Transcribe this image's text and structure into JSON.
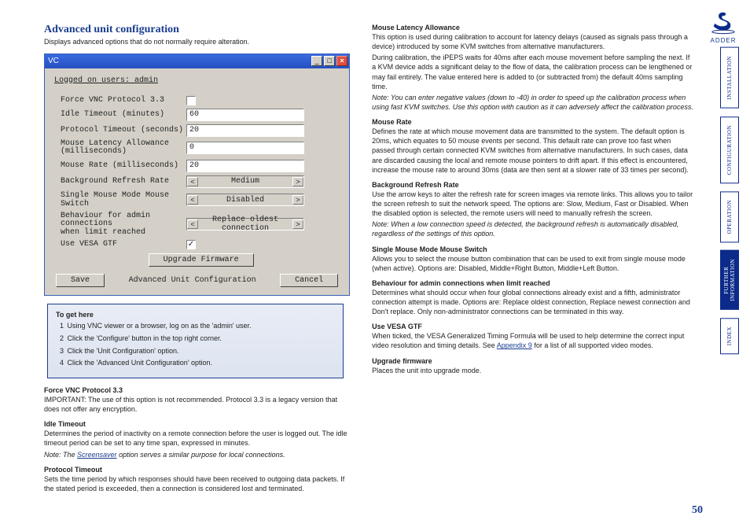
{
  "title": "Advanced unit configuration",
  "intro": "Displays advanced options that do not normally require alteration.",
  "dialog": {
    "title_left": "VC",
    "logged": "Logged on users: admin",
    "fields": {
      "force_vnc": {
        "label": "Force VNC Protocol 3.3",
        "checked": false
      },
      "idle_timeout": {
        "label": "Idle Timeout (minutes)",
        "value": "60"
      },
      "protocol_timeout": {
        "label": "Protocol Timeout (seconds)",
        "value": "20"
      },
      "mouse_latency": {
        "label_l1": "Mouse Latency Allowance",
        "label_l2": "(milliseconds)",
        "value": "0"
      },
      "mouse_rate": {
        "label": "Mouse Rate (milliseconds)",
        "value": "20"
      },
      "bg_refresh": {
        "label": "Background Refresh Rate",
        "value": "Medium"
      },
      "single_mouse": {
        "label": "Single Mouse Mode Mouse Switch",
        "value": "Disabled"
      },
      "admin_behaviour": {
        "label_l1": "Behaviour for admin connections",
        "label_l2": "when limit reached",
        "value": "Replace oldest connection"
      },
      "use_vesa": {
        "label": "Use VESA GTF",
        "checked": true
      }
    },
    "upgrade": "Upgrade Firmware",
    "save": "Save",
    "center": "Advanced Unit Configuration",
    "cancel": "Cancel"
  },
  "togethere": {
    "heading": "To get here",
    "steps": [
      "Using VNC viewer or a browser, log on as the 'admin' user.",
      "Click the 'Configure' button in the top right corner.",
      "Click the 'Unit Configuration' option.",
      "Click the 'Advanced Unit Configuration' option."
    ]
  },
  "left_sections": [
    {
      "h": "Force VNC Protocol 3.3",
      "p": [
        "IMPORTANT: The use of this option is not recommended. Protocol 3.3 is a legacy version that does not offer any encryption."
      ]
    },
    {
      "h": "Idle Timeout",
      "p": [
        "Determines the period of inactivity on a remote connection before the user is logged out. The idle timeout period can be set to any time span, expressed in minutes."
      ],
      "note_pre": "Note: The ",
      "note_link": "Screensaver",
      "note_post": " option serves a similar purpose for local connections."
    },
    {
      "h": "Protocol Timeout",
      "p": [
        "Sets the time period by which responses should have been received to outgoing data packets. If the stated period is exceeded, then a connection is considered lost and terminated."
      ]
    }
  ],
  "right_sections": [
    {
      "h": "Mouse Latency Allowance",
      "p": [
        "This option is used during calibration to account for latency delays (caused as signals pass through a device) introduced by some KVM switches from alternative manufacturers.",
        "During calibration, the iPEPS waits for 40ms after each mouse movement before sampling the next. If a KVM device adds a significant delay to the flow of data, the calibration process can be lengthened or may fail entirely. The value entered here is added to (or subtracted from) the default 40ms sampling time."
      ],
      "note": "Note: You can enter negative values (down to -40) in order to speed up the calibration process when using fast KVM switches. Use this option with caution as it can adversely affect the calibration process."
    },
    {
      "h": "Mouse Rate",
      "p": [
        "Defines the rate at which mouse movement data are transmitted to the system. The default option is 20ms, which equates to 50 mouse events per second. This default rate can prove too fast when passed through certain connected KVM switches from alternative manufacturers. In such cases, data are discarded causing the local and remote mouse pointers to drift apart. If this effect is encountered, increase the mouse rate to around 30ms (data are then sent at a slower rate of 33 times per second)."
      ]
    },
    {
      "h": "Background Refresh Rate",
      "p": [
        "Use the arrow keys to alter the refresh rate for screen images via remote links. This allows you to tailor the screen refresh to suit the network speed. The options are: Slow, Medium, Fast or Disabled. When the disabled option is selected, the remote users will need to manually refresh the screen."
      ],
      "note": "Note: When a low connection speed is detected, the background refresh is automatically disabled, regardless of the settings of this option."
    },
    {
      "h": "Single Mouse Mode Mouse Switch",
      "p": [
        "Allows you to select the mouse button combination that can be used to exit from single mouse mode (when active). Options are: Disabled, Middle+Right Button, Middle+Left Button."
      ]
    },
    {
      "h": "Behaviour for admin connections when limit reached",
      "p": [
        "Determines what should occur when four global connections already exist and a fifth, administrator connection attempt is made. Options are: Replace oldest connection, Replace newest connection and Don't replace. Only non-administrator connections can be terminated in this way."
      ]
    },
    {
      "h": "Use VESA GTF",
      "p_pre": "When ticked, the VESA Generalized Timing Formula will be used to help determine the correct input video resolution and timing details. See ",
      "p_link": "Appendix 9",
      "p_post": " for a list of all supported video modes."
    },
    {
      "h": "Upgrade firmware",
      "p": [
        "Places the unit into upgrade mode."
      ]
    }
  ],
  "tabs": [
    {
      "label": "INSTALLATION",
      "active": false
    },
    {
      "label": "CONFIGURATION",
      "active": false
    },
    {
      "label": "OPERATION",
      "active": false
    },
    {
      "label": "FURTHER\nINFORMATION",
      "active": true
    },
    {
      "label": "INDEX",
      "active": false
    }
  ],
  "brand": "ADDER",
  "page_num": "50"
}
